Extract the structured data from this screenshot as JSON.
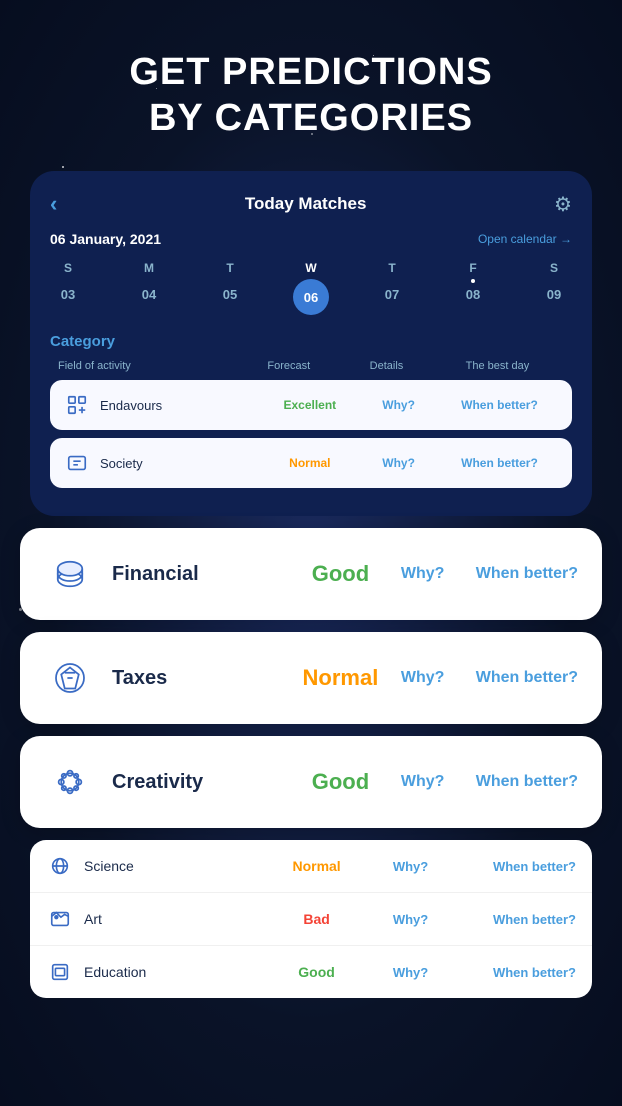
{
  "page": {
    "title_line1": "GET PREDICTIONS",
    "title_line2": "BY CATEGORIES"
  },
  "calendar": {
    "back_label": "‹",
    "title": "Today Matches",
    "settings_icon": "⚙",
    "date": "06 January, 2021",
    "open_calendar": "Open calendar →",
    "days": [
      {
        "letter": "S",
        "num": "03",
        "active": false
      },
      {
        "letter": "M",
        "num": "04",
        "active": false
      },
      {
        "letter": "T",
        "num": "05",
        "active": false
      },
      {
        "letter": "W",
        "num": "06",
        "active": true
      },
      {
        "letter": "T",
        "num": "07",
        "active": false
      },
      {
        "letter": "F",
        "num": "08",
        "active": false
      },
      {
        "letter": "S",
        "num": "09",
        "active": false
      }
    ],
    "category_label": "Category",
    "columns": {
      "field": "Field of activity",
      "forecast": "Forecast",
      "details": "Details",
      "best": "The best day"
    },
    "rows": [
      {
        "name": "Endavours",
        "forecast": "Excellent",
        "forecast_class": "excellent",
        "why": "Why?",
        "better": "When better?"
      },
      {
        "name": "Society",
        "forecast": "Normal",
        "forecast_class": "normal",
        "why": "Why?",
        "better": "When better?"
      }
    ]
  },
  "expanded_cards": [
    {
      "name": "Financial",
      "forecast": "Good",
      "forecast_class": "good",
      "why": "Why?",
      "better": "When better?"
    },
    {
      "name": "Taxes",
      "forecast": "Normal",
      "forecast_class": "normal",
      "why": "Why?",
      "better": "When better?"
    },
    {
      "name": "Creativity",
      "forecast": "Good",
      "forecast_class": "good",
      "why": "Why?",
      "better": "When better?"
    }
  ],
  "bottom_rows": [
    {
      "name": "Science",
      "forecast": "Normal",
      "forecast_class": "normal",
      "why": "Why?",
      "better": "When better?"
    },
    {
      "name": "Art",
      "forecast": "Bad",
      "forecast_class": "bad",
      "why": "Why?",
      "better": "When better?"
    },
    {
      "name": "Education",
      "forecast": "Good",
      "forecast_class": "good",
      "why": "Why?",
      "better": "When better?"
    }
  ],
  "colors": {
    "excellent": "#4caf50",
    "good": "#4caf50",
    "normal": "#ff9800",
    "bad": "#f44336"
  }
}
